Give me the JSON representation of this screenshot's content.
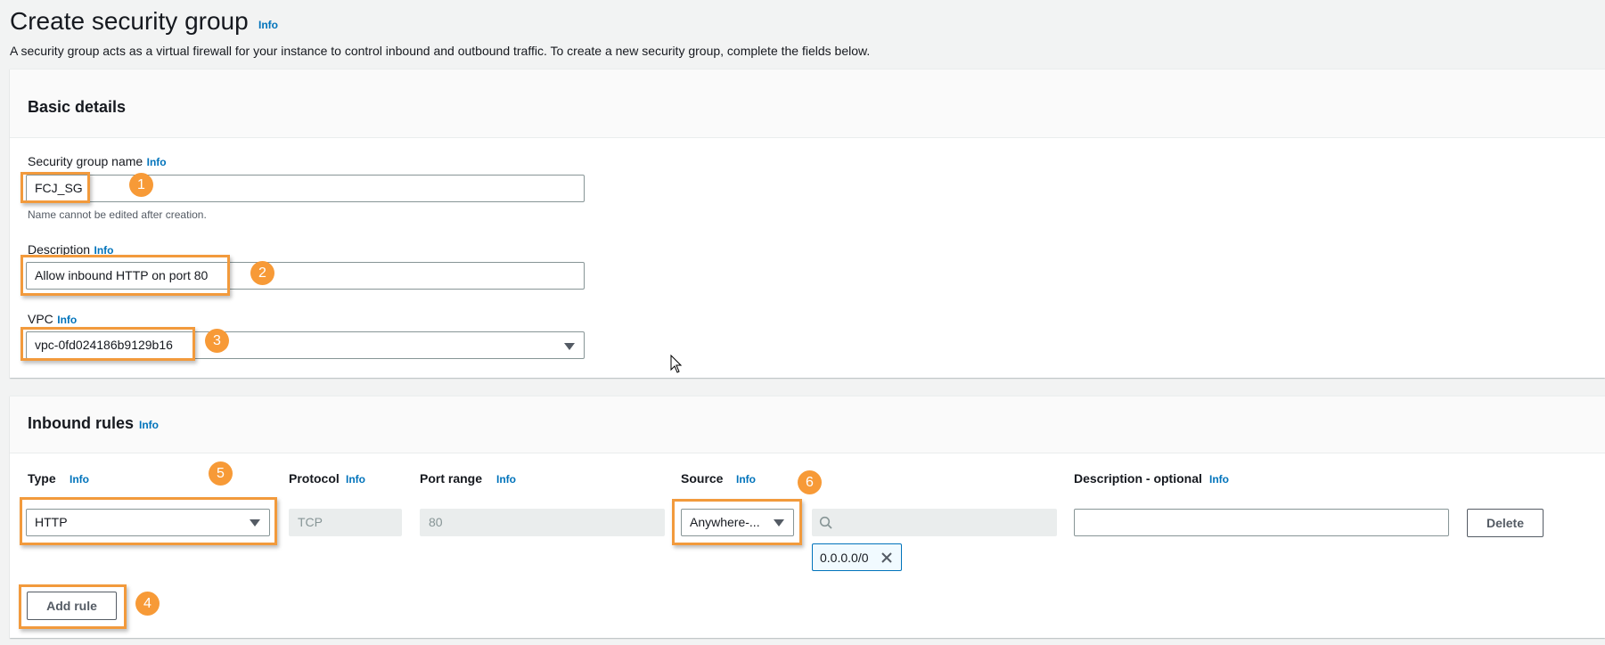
{
  "page": {
    "title": "Create security group",
    "title_info": "Info",
    "subtitle": "A security group acts as a virtual firewall for your instance to control inbound and outbound traffic. To create a new security group, complete the fields below."
  },
  "basic_details": {
    "heading": "Basic details",
    "name": {
      "label": "Security group name",
      "info": "Info",
      "value": "FCJ_SG",
      "hint": "Name cannot be edited after creation."
    },
    "description": {
      "label": "Description",
      "info": "Info",
      "value": "Allow inbound HTTP on port 80"
    },
    "vpc": {
      "label": "VPC",
      "info": "Info",
      "value": "vpc-0fd024186b9129b16"
    }
  },
  "inbound_rules": {
    "heading": "Inbound rules",
    "info": "Info",
    "columns": {
      "type": "Type",
      "type_info": "Info",
      "protocol": "Protocol",
      "protocol_info": "Info",
      "port_range": "Port range",
      "port_range_info": "Info",
      "source": "Source",
      "source_info": "Info",
      "description": "Description - optional",
      "description_info": "Info"
    },
    "rule": {
      "type": "HTTP",
      "protocol": "TCP",
      "port_range": "80",
      "source": "Anywhere-...",
      "source_search": "",
      "cidr_token": "0.0.0.0/0",
      "description": "",
      "delete_label": "Delete"
    },
    "add_rule_label": "Add rule"
  },
  "annotations": [
    "1",
    "2",
    "3",
    "4",
    "5",
    "6"
  ],
  "colors": {
    "highlight": "#f29a3c",
    "badge": "#f79a37",
    "link": "#0073bb"
  }
}
